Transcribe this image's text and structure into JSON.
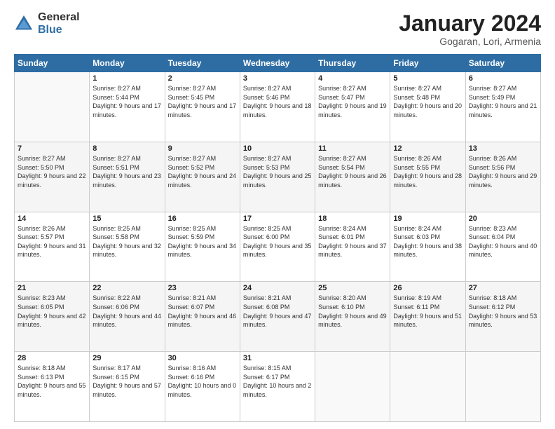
{
  "logo": {
    "general": "General",
    "blue": "Blue"
  },
  "header": {
    "month": "January 2024",
    "location": "Gogaran, Lori, Armenia"
  },
  "weekdays": [
    "Sunday",
    "Monday",
    "Tuesday",
    "Wednesday",
    "Thursday",
    "Friday",
    "Saturday"
  ],
  "weeks": [
    [
      {
        "day": "",
        "sunrise": "",
        "sunset": "",
        "daylight": ""
      },
      {
        "day": "1",
        "sunrise": "Sunrise: 8:27 AM",
        "sunset": "Sunset: 5:44 PM",
        "daylight": "Daylight: 9 hours and 17 minutes."
      },
      {
        "day": "2",
        "sunrise": "Sunrise: 8:27 AM",
        "sunset": "Sunset: 5:45 PM",
        "daylight": "Daylight: 9 hours and 17 minutes."
      },
      {
        "day": "3",
        "sunrise": "Sunrise: 8:27 AM",
        "sunset": "Sunset: 5:46 PM",
        "daylight": "Daylight: 9 hours and 18 minutes."
      },
      {
        "day": "4",
        "sunrise": "Sunrise: 8:27 AM",
        "sunset": "Sunset: 5:47 PM",
        "daylight": "Daylight: 9 hours and 19 minutes."
      },
      {
        "day": "5",
        "sunrise": "Sunrise: 8:27 AM",
        "sunset": "Sunset: 5:48 PM",
        "daylight": "Daylight: 9 hours and 20 minutes."
      },
      {
        "day": "6",
        "sunrise": "Sunrise: 8:27 AM",
        "sunset": "Sunset: 5:49 PM",
        "daylight": "Daylight: 9 hours and 21 minutes."
      }
    ],
    [
      {
        "day": "7",
        "sunrise": "Sunrise: 8:27 AM",
        "sunset": "Sunset: 5:50 PM",
        "daylight": "Daylight: 9 hours and 22 minutes."
      },
      {
        "day": "8",
        "sunrise": "Sunrise: 8:27 AM",
        "sunset": "Sunset: 5:51 PM",
        "daylight": "Daylight: 9 hours and 23 minutes."
      },
      {
        "day": "9",
        "sunrise": "Sunrise: 8:27 AM",
        "sunset": "Sunset: 5:52 PM",
        "daylight": "Daylight: 9 hours and 24 minutes."
      },
      {
        "day": "10",
        "sunrise": "Sunrise: 8:27 AM",
        "sunset": "Sunset: 5:53 PM",
        "daylight": "Daylight: 9 hours and 25 minutes."
      },
      {
        "day": "11",
        "sunrise": "Sunrise: 8:27 AM",
        "sunset": "Sunset: 5:54 PM",
        "daylight": "Daylight: 9 hours and 26 minutes."
      },
      {
        "day": "12",
        "sunrise": "Sunrise: 8:26 AM",
        "sunset": "Sunset: 5:55 PM",
        "daylight": "Daylight: 9 hours and 28 minutes."
      },
      {
        "day": "13",
        "sunrise": "Sunrise: 8:26 AM",
        "sunset": "Sunset: 5:56 PM",
        "daylight": "Daylight: 9 hours and 29 minutes."
      }
    ],
    [
      {
        "day": "14",
        "sunrise": "Sunrise: 8:26 AM",
        "sunset": "Sunset: 5:57 PM",
        "daylight": "Daylight: 9 hours and 31 minutes."
      },
      {
        "day": "15",
        "sunrise": "Sunrise: 8:25 AM",
        "sunset": "Sunset: 5:58 PM",
        "daylight": "Daylight: 9 hours and 32 minutes."
      },
      {
        "day": "16",
        "sunrise": "Sunrise: 8:25 AM",
        "sunset": "Sunset: 5:59 PM",
        "daylight": "Daylight: 9 hours and 34 minutes."
      },
      {
        "day": "17",
        "sunrise": "Sunrise: 8:25 AM",
        "sunset": "Sunset: 6:00 PM",
        "daylight": "Daylight: 9 hours and 35 minutes."
      },
      {
        "day": "18",
        "sunrise": "Sunrise: 8:24 AM",
        "sunset": "Sunset: 6:01 PM",
        "daylight": "Daylight: 9 hours and 37 minutes."
      },
      {
        "day": "19",
        "sunrise": "Sunrise: 8:24 AM",
        "sunset": "Sunset: 6:03 PM",
        "daylight": "Daylight: 9 hours and 38 minutes."
      },
      {
        "day": "20",
        "sunrise": "Sunrise: 8:23 AM",
        "sunset": "Sunset: 6:04 PM",
        "daylight": "Daylight: 9 hours and 40 minutes."
      }
    ],
    [
      {
        "day": "21",
        "sunrise": "Sunrise: 8:23 AM",
        "sunset": "Sunset: 6:05 PM",
        "daylight": "Daylight: 9 hours and 42 minutes."
      },
      {
        "day": "22",
        "sunrise": "Sunrise: 8:22 AM",
        "sunset": "Sunset: 6:06 PM",
        "daylight": "Daylight: 9 hours and 44 minutes."
      },
      {
        "day": "23",
        "sunrise": "Sunrise: 8:21 AM",
        "sunset": "Sunset: 6:07 PM",
        "daylight": "Daylight: 9 hours and 46 minutes."
      },
      {
        "day": "24",
        "sunrise": "Sunrise: 8:21 AM",
        "sunset": "Sunset: 6:08 PM",
        "daylight": "Daylight: 9 hours and 47 minutes."
      },
      {
        "day": "25",
        "sunrise": "Sunrise: 8:20 AM",
        "sunset": "Sunset: 6:10 PM",
        "daylight": "Daylight: 9 hours and 49 minutes."
      },
      {
        "day": "26",
        "sunrise": "Sunrise: 8:19 AM",
        "sunset": "Sunset: 6:11 PM",
        "daylight": "Daylight: 9 hours and 51 minutes."
      },
      {
        "day": "27",
        "sunrise": "Sunrise: 8:18 AM",
        "sunset": "Sunset: 6:12 PM",
        "daylight": "Daylight: 9 hours and 53 minutes."
      }
    ],
    [
      {
        "day": "28",
        "sunrise": "Sunrise: 8:18 AM",
        "sunset": "Sunset: 6:13 PM",
        "daylight": "Daylight: 9 hours and 55 minutes."
      },
      {
        "day": "29",
        "sunrise": "Sunrise: 8:17 AM",
        "sunset": "Sunset: 6:15 PM",
        "daylight": "Daylight: 9 hours and 57 minutes."
      },
      {
        "day": "30",
        "sunrise": "Sunrise: 8:16 AM",
        "sunset": "Sunset: 6:16 PM",
        "daylight": "Daylight: 10 hours and 0 minutes."
      },
      {
        "day": "31",
        "sunrise": "Sunrise: 8:15 AM",
        "sunset": "Sunset: 6:17 PM",
        "daylight": "Daylight: 10 hours and 2 minutes."
      },
      {
        "day": "",
        "sunrise": "",
        "sunset": "",
        "daylight": ""
      },
      {
        "day": "",
        "sunrise": "",
        "sunset": "",
        "daylight": ""
      },
      {
        "day": "",
        "sunrise": "",
        "sunset": "",
        "daylight": ""
      }
    ]
  ]
}
